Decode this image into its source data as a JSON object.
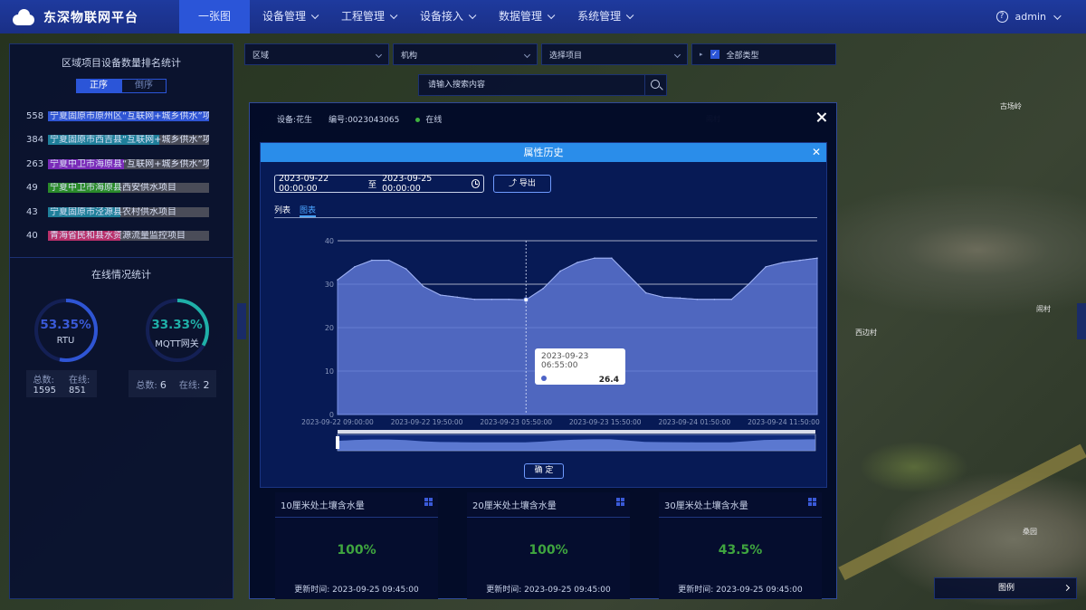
{
  "app": {
    "title": "东深物联网平台",
    "user": "admin"
  },
  "nav": [
    {
      "label": "一张图",
      "active": true,
      "dropdown": false
    },
    {
      "label": "设备管理",
      "dropdown": true
    },
    {
      "label": "工程管理",
      "dropdown": true
    },
    {
      "label": "设备接入",
      "dropdown": true
    },
    {
      "label": "数据管理",
      "dropdown": true
    },
    {
      "label": "系统管理",
      "dropdown": true
    }
  ],
  "filters": {
    "region": "区域",
    "org": "机构",
    "project": "选择项目",
    "all_types": "全部类型",
    "search_placeholder": "请输入搜索内容"
  },
  "ranking": {
    "title": "区域项目设备数量排名统计",
    "sort_asc": "正序",
    "sort_desc": "倒序",
    "items": [
      {
        "count": "558",
        "label": "宁夏固原市原州区“互联网+城乡供水”项目",
        "color": "#2f55d4",
        "ratio": 1.0
      },
      {
        "count": "384",
        "label": "宁夏固原市西吉县“互联网+城乡供水”项目",
        "color": "#1f7f9a",
        "ratio": 0.69
      },
      {
        "count": "263",
        "label": "宁夏中卫市海原县“互联网+城乡供水”项目",
        "color": "#7a2bb8",
        "ratio": 0.47
      },
      {
        "count": "49",
        "label": "宁夏中卫市海原县西安供水项目",
        "color": "#2a8a2a",
        "ratio": 0.09
      },
      {
        "count": "43",
        "label": "宁夏固原市泾源县农村供水项目",
        "color": "#1f7f9a",
        "ratio": 0.08
      },
      {
        "count": "40",
        "label": "青海省民和县水资源流量监控项目",
        "color": "#b8306a",
        "ratio": 0.07
      }
    ]
  },
  "online": {
    "title": "在线情况统计",
    "rtu": {
      "pct": "53.35%",
      "label": "RTU",
      "ratio": 0.5335,
      "color": "#2f55d4",
      "total_label": "总数:",
      "total": "1595",
      "online_label": "在线:",
      "online": "851"
    },
    "mqtt": {
      "pct": "33.33%",
      "label": "MQTT网关",
      "ratio": 0.3333,
      "color": "#1fb0a8",
      "total_label": "总数:",
      "total": "6",
      "online_label": "在线:",
      "online": "2"
    }
  },
  "device": {
    "name": "设备:花生",
    "code": "编号:0023043065",
    "status": "在线",
    "status_color": "#3fb23f"
  },
  "history": {
    "title": "属性历史",
    "start": "2023-09-22 00:00:00",
    "sep": "至",
    "end": "2023-09-25 00:00:00",
    "export": "导出",
    "tab_list": "列表",
    "tab_chart": "图表",
    "confirm": "确 定",
    "tooltip_time": "2023-09-23 06:55:00",
    "tooltip_value": "26.4"
  },
  "chart_data": {
    "type": "area",
    "ylim": [
      0,
      40
    ],
    "yticks": [
      "0",
      "10",
      "20",
      "30",
      "40"
    ],
    "xticks": [
      "2023-09-22 09:00:00",
      "2023-09-22 19:50:00",
      "2023-09-23 05:50:00",
      "2023-09-23 15:50:00",
      "2023-09-24 01:50:00",
      "2023-09-24 11:50:00"
    ],
    "x": [
      "09-22 09:00",
      "09-22 11:00",
      "09-22 13:00",
      "09-22 15:00",
      "09-22 17:00",
      "09-22 19:00",
      "09-22 21:00",
      "09-22 23:00",
      "09-23 01:00",
      "09-23 03:00",
      "09-23 05:00",
      "09-23 06:55",
      "09-23 09:00",
      "09-23 11:00",
      "09-23 13:00",
      "09-23 15:00",
      "09-23 17:00",
      "09-23 19:00",
      "09-23 21:00",
      "09-23 23:00",
      "09-24 01:00",
      "09-24 03:00",
      "09-24 05:00",
      "09-24 07:00",
      "09-24 09:00",
      "09-24 11:00",
      "09-24 13:00",
      "09-24 15:00",
      "09-24 17:00"
    ],
    "values": [
      31,
      34,
      35.5,
      35.5,
      33.5,
      29.5,
      27.5,
      27,
      26.5,
      26.5,
      26.5,
      26.4,
      29,
      33,
      35,
      36,
      36,
      32,
      28,
      27,
      26.8,
      26.5,
      26.5,
      26.5,
      30,
      34,
      35,
      35.5,
      36
    ],
    "tooltip_index": 11
  },
  "cards": [
    {
      "title": "10厘米处土壤含水量",
      "value": "100%",
      "time": "更新时间: 2023-09-25 09:45:00"
    },
    {
      "title": "20厘米处土壤含水量",
      "value": "100%",
      "time": "更新时间: 2023-09-25 09:45:00"
    },
    {
      "title": "30厘米处土壤含水量",
      "value": "43.5%",
      "time": "更新时间: 2023-09-25 09:45:00"
    }
  ],
  "legend": {
    "label": "图例"
  },
  "map": {
    "labels": [
      "古场岭",
      "闹村",
      "西边村",
      "闹村",
      "闹村",
      "桑园"
    ]
  }
}
